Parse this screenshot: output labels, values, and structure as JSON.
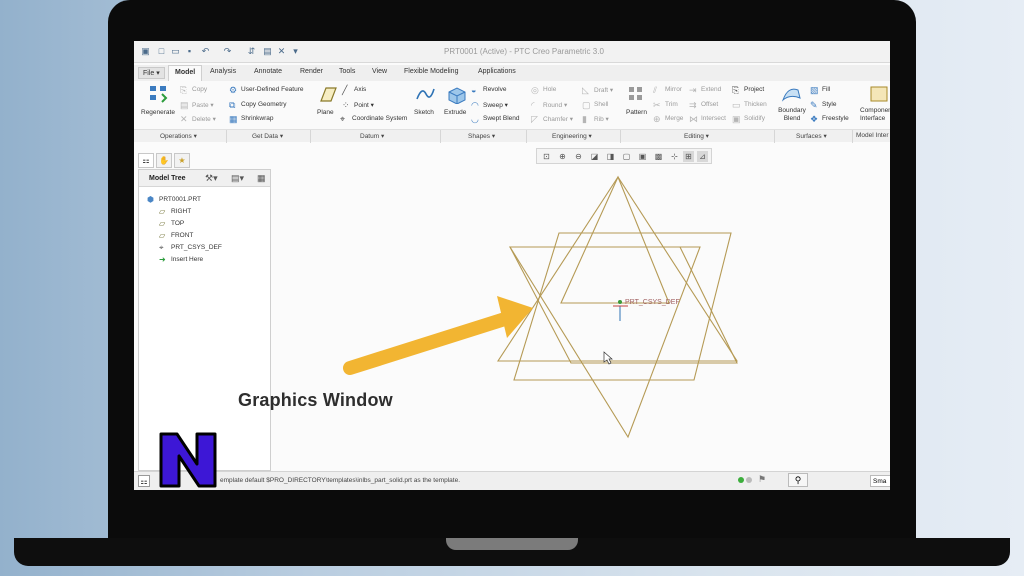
{
  "window": {
    "title": "PRT0001 (Active) - PTC Creo Parametric 3.0"
  },
  "menu": {
    "file": "File ▾",
    "tabs": [
      "Model",
      "Analysis",
      "Annotate",
      "Render",
      "Tools",
      "View",
      "Flexible Modeling",
      "Applications"
    ]
  },
  "ribbon": {
    "regenerate": "Regenerate",
    "operations_small": [
      "Copy",
      "Paste ▾",
      "Delete ▾"
    ],
    "getdata": [
      "User-Defined Feature",
      "Copy Geometry",
      "Shrinkwrap"
    ],
    "plane": "Plane",
    "datum": [
      "Axis",
      "Point ▾",
      "Coordinate System"
    ],
    "sketch": "Sketch",
    "extrude": "Extrude",
    "shapes": [
      "Revolve",
      "Sweep ▾",
      "Swept Blend"
    ],
    "engineering": [
      "Hole",
      "Round ▾",
      "Chamfer ▾"
    ],
    "engineering2": [
      "Draft ▾",
      "Shell",
      "Rib ▾"
    ],
    "pattern": "Pattern",
    "editing": [
      "Mirror",
      "Trim",
      "Merge"
    ],
    "editing2": [
      "Extend",
      "Offset",
      "Intersect"
    ],
    "editing3": [
      "Project",
      "Thicken",
      "Solidify"
    ],
    "boundary": "Boundary Blend",
    "surfaces": [
      "Fill",
      "Style",
      "Freestyle"
    ],
    "component": "Component Interface",
    "groups": [
      "Operations ▾",
      "Get Data ▾",
      "Datum ▾",
      "Shapes ▾",
      "Engineering ▾",
      "Editing ▾",
      "Surfaces ▾",
      "Model Inter"
    ]
  },
  "tree": {
    "title": "Model Tree",
    "items": [
      "PRT0001.PRT",
      "RIGHT",
      "TOP",
      "FRONT",
      "PRT_CSYS_DEF",
      "Insert Here"
    ]
  },
  "graphics": {
    "csys_label": "PRT_CSYS_DEF"
  },
  "status": {
    "message": "emplate default $PRO_DIRECTORY\\templates\\inlbs_part_solid.prt as the template.",
    "filter": "Sma"
  },
  "overlay": {
    "callout": "Graphics Window",
    "arrow_color": "#f2b532",
    "logo_color": "#3d17d6"
  }
}
